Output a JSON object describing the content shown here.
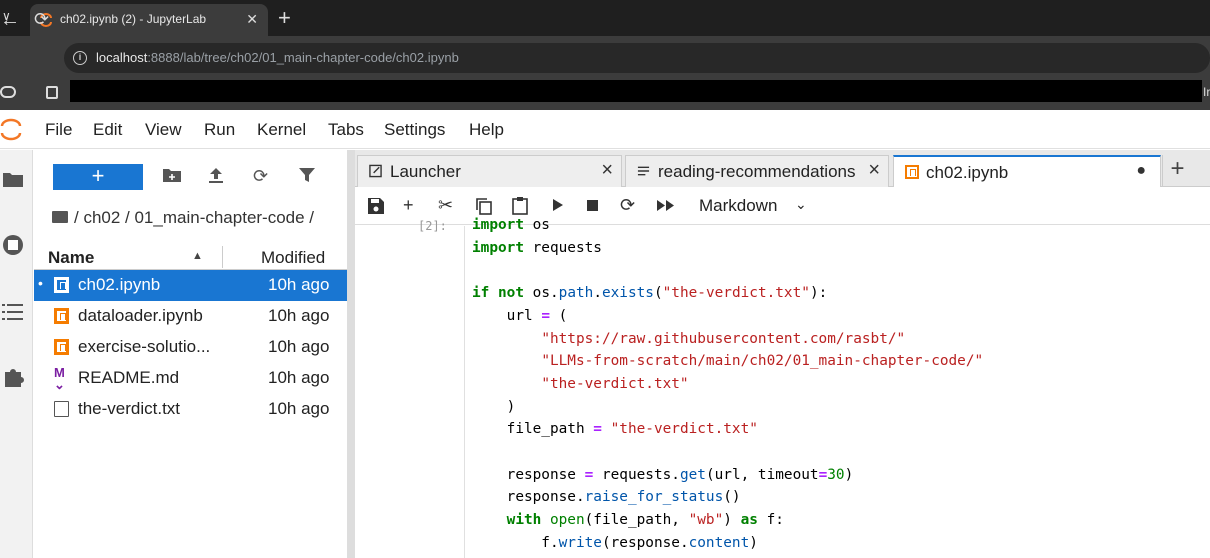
{
  "browser": {
    "tab_title": "ch02.ipynb (2) - JupyterLab",
    "url_host": "localhost",
    "url_rest": ":8888/lab/tree/ch02/01_main-chapter-code/ch02.ipynb",
    "bookmark_trailing": "Ir"
  },
  "menu": [
    "File",
    "Edit",
    "View",
    "Run",
    "Kernel",
    "Tabs",
    "Settings",
    "Help"
  ],
  "filebrowser": {
    "new_label": "+",
    "breadcrumb": "/ ch02 / 01_main-chapter-code /",
    "col_name": "Name",
    "col_modified": "Modified",
    "files": [
      {
        "name": "ch02.ipynb",
        "modified": "10h ago",
        "type": "notebook",
        "selected": true
      },
      {
        "name": "dataloader.ipynb",
        "modified": "10h ago",
        "type": "notebook",
        "selected": false
      },
      {
        "name": "exercise-solutio...",
        "modified": "10h ago",
        "type": "notebook",
        "selected": false
      },
      {
        "name": "README.md",
        "modified": "10h ago",
        "type": "markdown",
        "selected": false
      },
      {
        "name": "the-verdict.txt",
        "modified": "10h ago",
        "type": "text",
        "selected": false
      }
    ]
  },
  "tabs": [
    {
      "label": "Launcher",
      "active": false
    },
    {
      "label": "reading-recommendations",
      "active": false
    },
    {
      "label": "ch02.ipynb",
      "active": true
    }
  ],
  "notebook": {
    "cell_type": "Markdown",
    "prompt": "[2]:",
    "code_lines": [
      "import os",
      "import requests",
      "",
      "if not os.path.exists(\"the-verdict.txt\"):",
      "    url = (",
      "        \"https://raw.githubusercontent.com/rasbt/\"",
      "        \"LLMs-from-scratch/main/ch02/01_main-chapter-code/\"",
      "        \"the-verdict.txt\"",
      "    )",
      "    file_path = \"the-verdict.txt\"",
      "",
      "    response = requests.get(url, timeout=30)",
      "    response.raise_for_status()",
      "    with open(file_path, \"wb\") as f:",
      "        f.write(response.content)"
    ]
  },
  "colors": {
    "accent": "#1976d2",
    "notebook_icon": "#f57c00",
    "markdown_icon": "#7b1fa2"
  }
}
